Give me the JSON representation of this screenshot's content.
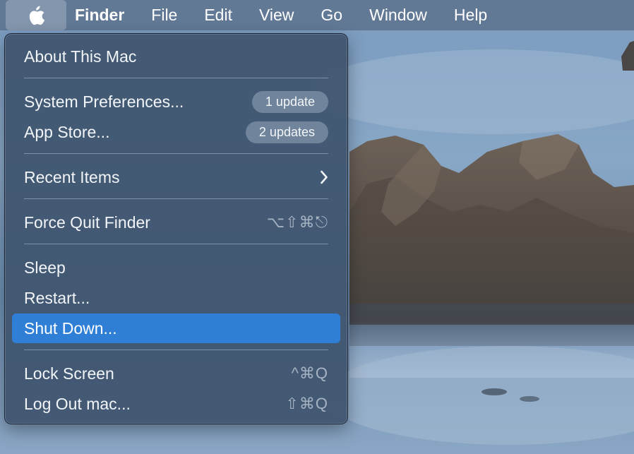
{
  "menubar": {
    "apple_icon": "apple-logo-icon",
    "app_name": "Finder",
    "items": [
      "File",
      "Edit",
      "View",
      "Go",
      "Window",
      "Help"
    ]
  },
  "apple_menu": {
    "items": {
      "about": {
        "label": "About This Mac"
      },
      "system_prefs": {
        "label": "System Preferences...",
        "badge": "1 update"
      },
      "app_store": {
        "label": "App Store...",
        "badge": "2 updates"
      },
      "recent_items": {
        "label": "Recent Items",
        "submenu_icon": "chevron-right-icon"
      },
      "force_quit": {
        "label": "Force Quit Finder",
        "shortcut": "⌥⇧⌘⎋"
      },
      "sleep": {
        "label": "Sleep"
      },
      "restart": {
        "label": "Restart..."
      },
      "shut_down": {
        "label": "Shut Down...",
        "selected": true
      },
      "lock_screen": {
        "label": "Lock Screen",
        "shortcut": "^⌘Q"
      },
      "log_out": {
        "label": "Log Out mac...",
        "shortcut": "⇧⌘Q"
      }
    }
  },
  "colors": {
    "selection": "#2f7fd6",
    "menu_background": "#3e546e",
    "menubar_background": "#5f7692"
  }
}
